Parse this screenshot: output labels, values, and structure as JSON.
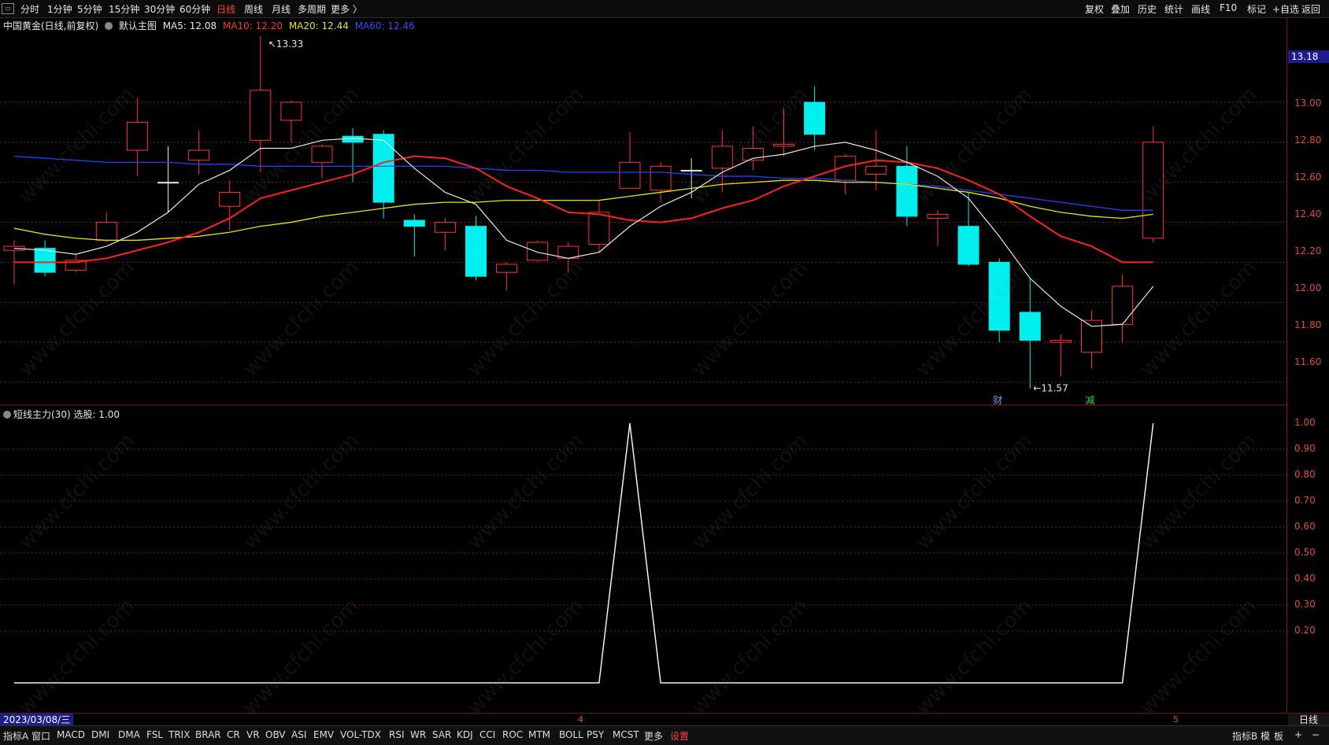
{
  "top_tabs": [
    "分时",
    "1分钟",
    "5分钟",
    "15分钟",
    "30分钟",
    "60分钟",
    "日线",
    "周线",
    "月线",
    "多周期",
    "更多 〉"
  ],
  "active_tab": "日线",
  "right_tools": [
    "复权",
    "叠加",
    "历史",
    "统计",
    "画线",
    "F10",
    "标记",
    "+自选",
    "返回"
  ],
  "info": {
    "stock": "中国黄金(日线,前复权)",
    "template": "默认主图",
    "ma5": "MA5: 12.08",
    "ma10": "MA10: 12.20",
    "ma20": "MA20: 12.44",
    "ma60": "MA60: 12.46"
  },
  "sub_info": "短线主力(30) 选股: 1.00",
  "price_axis": [
    "13.00",
    "12.80",
    "12.60",
    "12.40",
    "12.20",
    "12.00",
    "11.80",
    "11.60"
  ],
  "last_price": "13.18",
  "sub_axis": [
    "1.00",
    "0.90",
    "0.80",
    "0.70",
    "0.60",
    "0.50",
    "0.40",
    "0.30",
    "0.20"
  ],
  "annotations": {
    "high": "13.33",
    "low": "11.57",
    "marker1": "财",
    "marker2": "减"
  },
  "date_label": "2023/03/08/三",
  "month_marks": [
    "4",
    "5"
  ],
  "period_label": "日线",
  "bottom_tabs": [
    "指标A",
    "窗口",
    "MACD",
    "DMI",
    "DMA",
    "FSL",
    "TRIX",
    "BRAR",
    "CR",
    "VR",
    "OBV",
    "ASI",
    "EMV",
    "VOL-TDX",
    "RSI",
    "WR",
    "SAR",
    "KDJ",
    "CCI",
    "ROC",
    "MTM",
    "BOLL",
    "PSY",
    "MCST",
    "更多",
    "设置"
  ],
  "bottom_right": [
    "指标B",
    "模",
    "板",
    "+",
    "−"
  ],
  "watermark": "www.cfchi.com",
  "colors": {
    "up": "#ff3232",
    "down": "#00f0f0",
    "ma5": "#e8e8e8",
    "ma10": "#ff2020",
    "ma20": "#e6e600",
    "ma60": "#2040ff",
    "grid": "#7a1a1a"
  },
  "chart_data": {
    "type": "candlestick",
    "price_range": [
      11.5,
      13.45
    ],
    "candles": [
      [
        12.26,
        12.31,
        12.09,
        12.28
      ],
      [
        12.27,
        12.31,
        12.13,
        12.15
      ],
      [
        12.16,
        12.24,
        12.15,
        12.21
      ],
      [
        12.31,
        12.45,
        12.3,
        12.4
      ],
      [
        12.76,
        13.02,
        12.63,
        12.9
      ],
      [
        12.6,
        12.78,
        12.45,
        12.6
      ],
      [
        12.71,
        12.86,
        12.64,
        12.76
      ],
      [
        12.48,
        12.61,
        12.36,
        12.55
      ],
      [
        12.81,
        13.33,
        12.65,
        13.06
      ],
      [
        12.91,
        13.01,
        12.8,
        13.0
      ],
      [
        12.7,
        12.79,
        12.62,
        12.78
      ],
      [
        12.83,
        12.87,
        12.6,
        12.8
      ],
      [
        12.84,
        12.86,
        12.42,
        12.5
      ],
      [
        12.41,
        12.44,
        12.23,
        12.38
      ],
      [
        12.35,
        12.42,
        12.26,
        12.4
      ],
      [
        12.38,
        12.43,
        12.11,
        12.13
      ],
      [
        12.15,
        12.2,
        12.06,
        12.19
      ],
      [
        12.21,
        12.31,
        12.2,
        12.3
      ],
      [
        12.22,
        12.3,
        12.15,
        12.28
      ],
      [
        12.29,
        12.51,
        12.25,
        12.45
      ],
      [
        12.57,
        12.85,
        12.57,
        12.7
      ],
      [
        12.56,
        12.7,
        12.5,
        12.68
      ],
      [
        12.66,
        12.72,
        12.52,
        12.66
      ],
      [
        12.67,
        12.86,
        12.55,
        12.78
      ],
      [
        12.71,
        12.88,
        12.66,
        12.77
      ],
      [
        12.78,
        12.97,
        12.73,
        12.79
      ],
      [
        13.0,
        13.08,
        12.76,
        12.84
      ],
      [
        12.61,
        12.74,
        12.54,
        12.73
      ],
      [
        12.64,
        12.86,
        12.56,
        12.68
      ],
      [
        12.68,
        12.78,
        12.38,
        12.43
      ],
      [
        12.42,
        12.46,
        12.28,
        12.44
      ],
      [
        12.38,
        12.55,
        12.18,
        12.19
      ],
      [
        12.2,
        12.22,
        11.8,
        11.86
      ],
      [
        11.95,
        12.12,
        11.57,
        11.81
      ],
      [
        11.8,
        11.84,
        11.63,
        11.81
      ],
      [
        11.75,
        11.96,
        11.67,
        11.91
      ],
      [
        11.89,
        12.14,
        11.8,
        12.08
      ],
      [
        12.32,
        12.88,
        12.3,
        12.8
      ]
    ],
    "ma5": [
      12.27,
      12.26,
      12.24,
      12.28,
      12.35,
      12.45,
      12.59,
      12.66,
      12.77,
      12.77,
      12.81,
      12.82,
      12.81,
      12.67,
      12.55,
      12.49,
      12.31,
      12.25,
      12.22,
      12.25,
      12.38,
      12.48,
      12.55,
      12.65,
      12.72,
      12.74,
      12.78,
      12.8,
      12.76,
      12.7,
      12.63,
      12.52,
      12.33,
      12.12,
      11.98,
      11.88,
      11.89,
      12.08
    ],
    "ma10": [
      12.2,
      12.2,
      12.2,
      12.22,
      12.26,
      12.3,
      12.35,
      12.42,
      12.52,
      12.56,
      12.6,
      12.64,
      12.7,
      12.73,
      12.72,
      12.67,
      12.58,
      12.52,
      12.45,
      12.44,
      12.41,
      12.4,
      12.42,
      12.47,
      12.51,
      12.58,
      12.63,
      12.68,
      12.71,
      12.7,
      12.67,
      12.61,
      12.54,
      12.43,
      12.33,
      12.28,
      12.2,
      12.2
    ],
    "ma20": [
      12.37,
      12.34,
      12.32,
      12.31,
      12.31,
      12.32,
      12.33,
      12.35,
      12.38,
      12.4,
      12.43,
      12.45,
      12.47,
      12.49,
      12.5,
      12.5,
      12.51,
      12.51,
      12.51,
      12.51,
      12.53,
      12.55,
      12.57,
      12.59,
      12.6,
      12.61,
      12.61,
      12.6,
      12.6,
      12.59,
      12.57,
      12.55,
      12.52,
      12.48,
      12.45,
      12.43,
      12.42,
      12.44
    ],
    "ma60": [
      12.73,
      12.72,
      12.71,
      12.7,
      12.7,
      12.7,
      12.69,
      12.69,
      12.68,
      12.68,
      12.68,
      12.68,
      12.68,
      12.68,
      12.68,
      12.67,
      12.66,
      12.66,
      12.65,
      12.65,
      12.65,
      12.65,
      12.64,
      12.63,
      12.63,
      12.62,
      12.62,
      12.61,
      12.6,
      12.59,
      12.58,
      12.56,
      12.54,
      12.52,
      12.5,
      12.48,
      12.46,
      12.46
    ],
    "signal": [
      0,
      0,
      0,
      0,
      0,
      0,
      0,
      0,
      0,
      0,
      0,
      0,
      0,
      0,
      0,
      0,
      0,
      0,
      0,
      0,
      1,
      0,
      0,
      0,
      0,
      0,
      0,
      0,
      0,
      0,
      0,
      0,
      0,
      0,
      0,
      0,
      0,
      1
    ],
    "signal_range": [
      0,
      1
    ]
  }
}
